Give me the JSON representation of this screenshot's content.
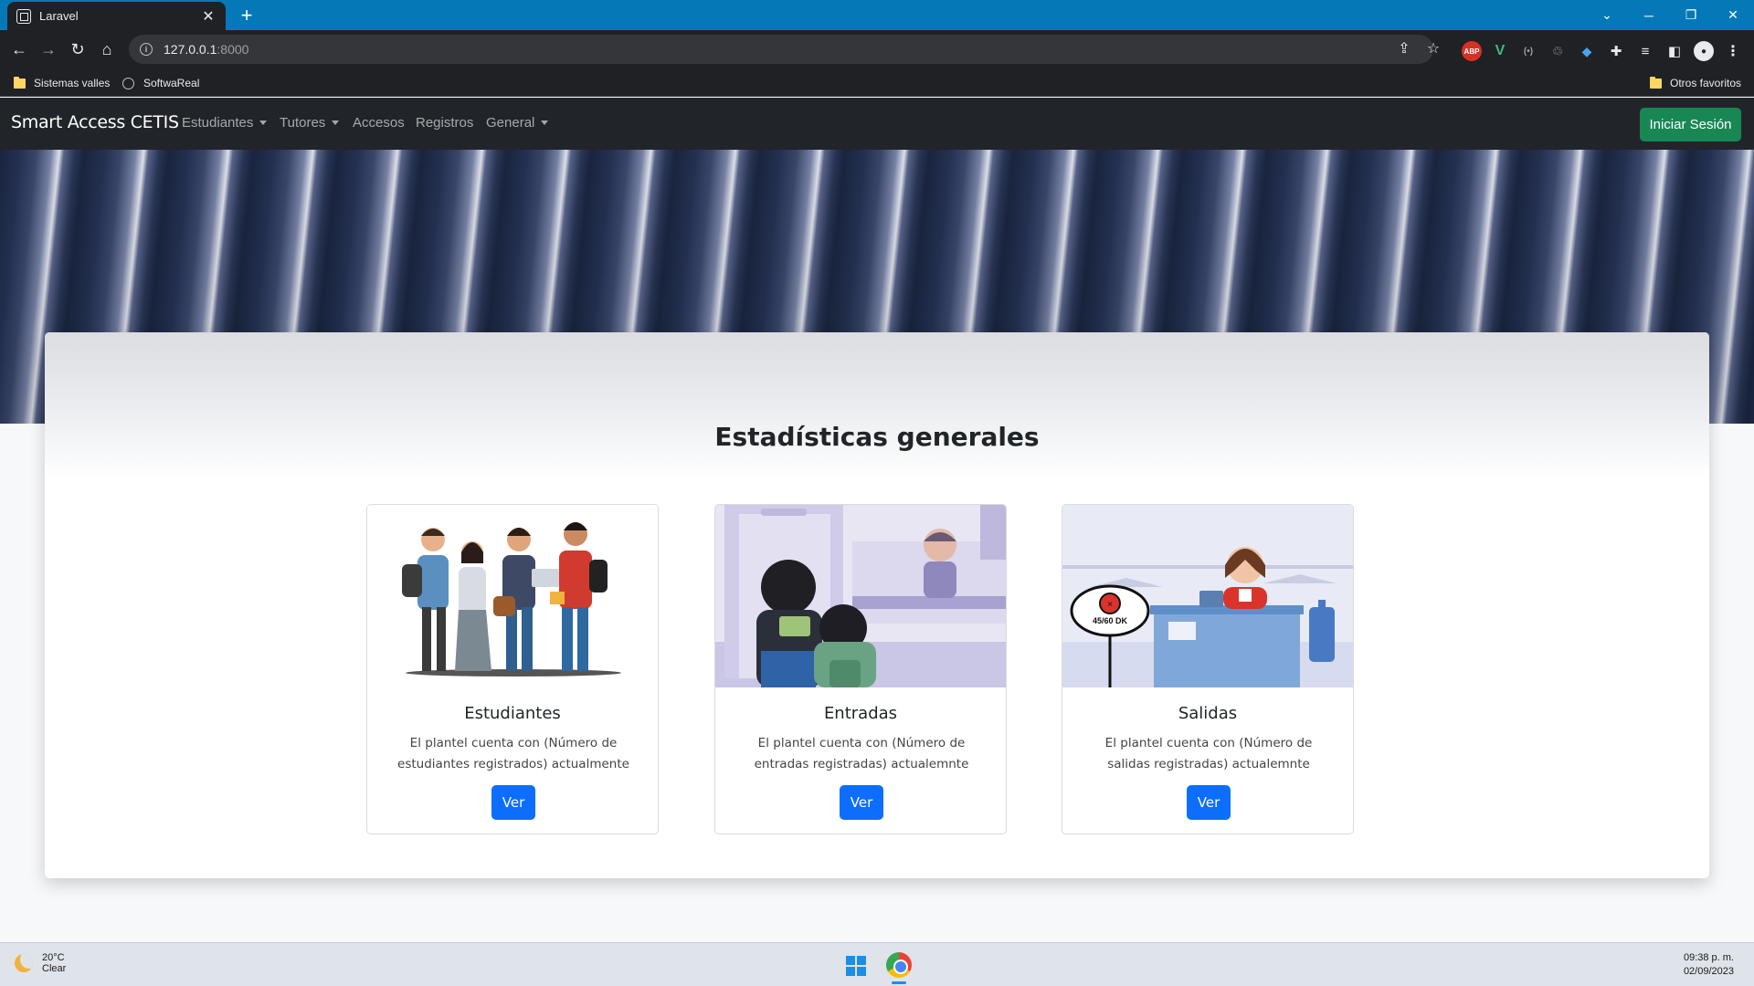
{
  "browser": {
    "tab_title": "Laravel",
    "tab_close": "✕",
    "new_tab": "+",
    "url_host": "127.0.0.1",
    "url_port": ":8000",
    "bookmarks": [
      {
        "label": "Sistemas valles",
        "icon": "folder-icon"
      },
      {
        "label": "SoftwaReal",
        "icon": "globe-icon"
      }
    ],
    "other_bookmarks": "Otros favoritos",
    "extensions": [
      "ABP",
      "V",
      "(•)"
    ]
  },
  "navbar": {
    "brand": "Smart Access CETIS",
    "links": [
      {
        "label": "Estudiantes",
        "dropdown": true
      },
      {
        "label": "Tutores",
        "dropdown": true
      },
      {
        "label": "Accesos",
        "dropdown": false
      },
      {
        "label": "Registros",
        "dropdown": false
      },
      {
        "label": "General",
        "dropdown": true
      }
    ],
    "login_label": "Iniciar Sesión",
    "login_color": "#198754"
  },
  "main": {
    "title": "Estadísticas generales",
    "cards": [
      {
        "title": "Estudiantes",
        "text": "El plantel cuenta con (Número de estudiantes registrados) actualmente",
        "button": "Ver",
        "image": "students-illustration"
      },
      {
        "title": "Entradas",
        "text": "El plantel cuenta con (Número de entradas registradas) actualemnte",
        "button": "Ver",
        "image": "entrance-illustration"
      },
      {
        "title": "Salidas",
        "text": "El plantel cuenta con (Número de salidas registradas) actualemnte",
        "button": "Ver",
        "image": "checkout-illustration"
      }
    ],
    "button_color": "#0d6efd",
    "sign_text": "45/60 DK"
  },
  "taskbar": {
    "temperature": "20°C",
    "condition": "Clear",
    "time": "09:38 p. m.",
    "date": "02/09/2023"
  }
}
